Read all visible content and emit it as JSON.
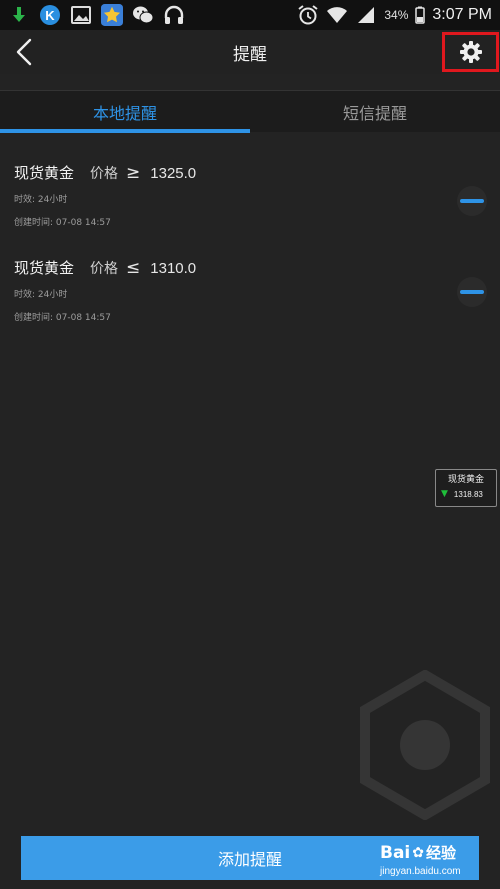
{
  "status_bar": {
    "icons_left": [
      "download-arrow-icon",
      "k-app-icon",
      "gallery-icon",
      "favorites-star-icon",
      "wechat-icon",
      "headphones-icon"
    ],
    "icons_right": [
      "alarm-icon",
      "wifi-icon",
      "signal-icon"
    ],
    "battery": "34%",
    "time": "3:07 PM"
  },
  "header": {
    "title": "提醒",
    "back_icon": "back-chevron-icon",
    "settings_icon": "gear-icon",
    "highlight_color": "#e0181e"
  },
  "tabs": [
    {
      "label": "本地提醒",
      "active": true
    },
    {
      "label": "短信提醒",
      "active": false
    }
  ],
  "accent_color": "#2e93e6",
  "alerts": [
    {
      "name": "现货黄金",
      "price_label": "价格",
      "operator": "≥",
      "price": "1325.0",
      "valid": "时效: 24小时",
      "created": "创建时间: 07-08 14:57"
    },
    {
      "name": "现货黄金",
      "price_label": "价格",
      "operator": "≤",
      "price": "1310.0",
      "valid": "时效: 24小时",
      "created": "创建时间: 07-08 14:57"
    }
  ],
  "widget": {
    "name": "现货黄金",
    "direction": "down",
    "price": "1318.83",
    "arrow_color": "#1fbf3a"
  },
  "add_button": {
    "label": "添加提醒"
  },
  "watermark": {
    "brand": "Bai",
    "brand_suffix": "经验",
    "url": "jingyan.baidu.com"
  }
}
